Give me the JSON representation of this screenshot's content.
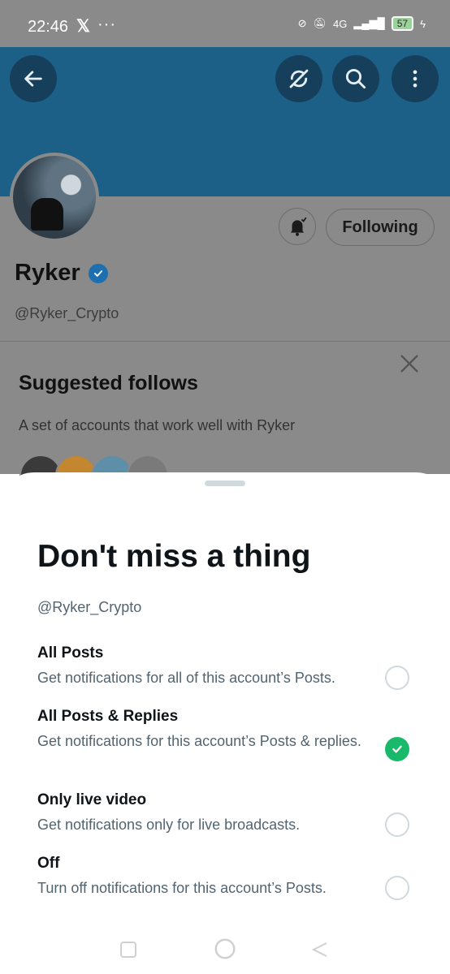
{
  "status_bar": {
    "time": "22:46",
    "network": "4G",
    "battery": "57"
  },
  "profile": {
    "name": "Ryker",
    "handle": "@Ryker_Crypto",
    "following_label": "Following"
  },
  "suggested": {
    "title": "Suggested follows",
    "subtitle": "A set of accounts that work well with Ryker"
  },
  "sheet": {
    "title": "Don't miss a thing",
    "handle": "@Ryker_Crypto",
    "options": [
      {
        "title": "All Posts",
        "desc": "Get notifications for all of this account’s Posts.",
        "selected": false
      },
      {
        "title": "All Posts & Replies",
        "desc": "Get notifications for this account’s Posts & replies.",
        "selected": true
      },
      {
        "title": "Only live video",
        "desc": "Get notifications only for live broadcasts.",
        "selected": false
      },
      {
        "title": "Off",
        "desc": "Turn off notifications for this account’s Posts.",
        "selected": false
      }
    ]
  },
  "colors": {
    "banner": "#1c5f87",
    "accent_green": "#18b96b",
    "muted_text": "#536471"
  },
  "icons": [
    "x-logo-icon",
    "back-arrow-icon",
    "sync-off-icon",
    "search-icon",
    "more-vertical-icon",
    "bell-icon",
    "verified-badge-icon",
    "close-icon",
    "check-icon"
  ]
}
